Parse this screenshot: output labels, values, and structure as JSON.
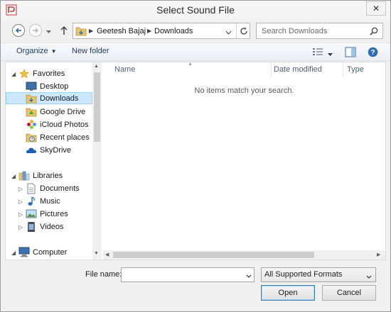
{
  "window": {
    "title": "Select Sound File",
    "close_glyph": "✕"
  },
  "nav": {
    "back_icon": "back-arrow-icon",
    "forward_icon": "forward-arrow-icon",
    "up_icon": "up-arrow-icon",
    "breadcrumbs": [
      "Geetesh Bajaj",
      "Downloads"
    ],
    "search_placeholder": "Search Downloads"
  },
  "toolbar": {
    "organize_label": "Organize",
    "new_folder_label": "New folder"
  },
  "tree": {
    "groups": [
      {
        "label": "Favorites",
        "icon": "star-icon",
        "items": [
          {
            "label": "Desktop",
            "icon": "desktop-icon"
          },
          {
            "label": "Downloads",
            "icon": "downloads-folder-icon",
            "selected": true
          },
          {
            "label": "Google Drive",
            "icon": "google-drive-icon"
          },
          {
            "label": "iCloud Photos",
            "icon": "icloud-photos-icon"
          },
          {
            "label": "Recent places",
            "icon": "recent-places-icon"
          },
          {
            "label": "SkyDrive",
            "icon": "skydrive-icon"
          }
        ]
      },
      {
        "label": "Libraries",
        "icon": "libraries-icon",
        "items": [
          {
            "label": "Documents",
            "icon": "documents-icon"
          },
          {
            "label": "Music",
            "icon": "music-icon"
          },
          {
            "label": "Pictures",
            "icon": "pictures-icon"
          },
          {
            "label": "Videos",
            "icon": "videos-icon"
          }
        ]
      },
      {
        "label": "Computer",
        "icon": "computer-icon",
        "items": []
      }
    ]
  },
  "filelist": {
    "columns": [
      "Name",
      "Date modified",
      "Type"
    ],
    "empty_message": "No items match your search."
  },
  "footer": {
    "file_name_label": "File name:",
    "file_name_value": "",
    "filter_value": "All Supported Formats",
    "open_label": "Open",
    "cancel_label": "Cancel"
  },
  "colors": {
    "selection_bg": "#cce8ff",
    "selection_border": "#99d1ff",
    "link_text": "#1e395b"
  }
}
